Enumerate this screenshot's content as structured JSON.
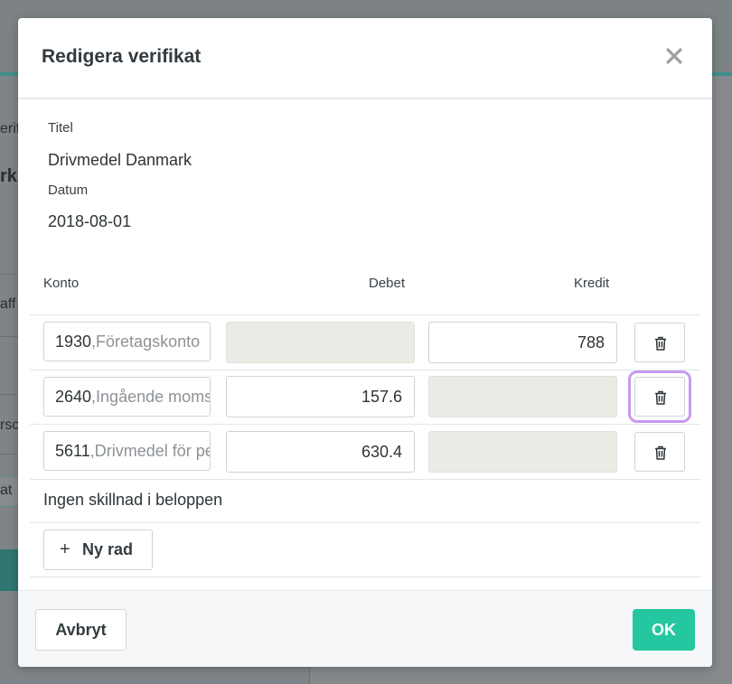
{
  "background": {
    "fragments": [
      "erif",
      "rk",
      "aff",
      "rsc",
      "at"
    ]
  },
  "modal": {
    "title": "Redigera verifikat",
    "close_icon": "close-icon",
    "title_label": "Titel",
    "title_value": "Drivmedel Danmark",
    "date_label": "Datum",
    "date_value": "2018-08-01"
  },
  "table": {
    "headers": {
      "account": "Konto",
      "debit": "Debet",
      "credit": "Kredit"
    },
    "rows": [
      {
        "account_number": "1930",
        "account_name": ",Företagskonto",
        "debit": "",
        "credit": "788"
      },
      {
        "account_number": "2640",
        "account_name": ",Ingående moms",
        "debit": "157.6",
        "credit": ""
      },
      {
        "account_number": "5611",
        "account_name": ",Drivmedel för personbilar",
        "debit": "630.4",
        "credit": ""
      }
    ],
    "delete_icon": "trash-icon"
  },
  "status": {
    "difference": "Ingen skillnad i beloppen"
  },
  "add_row": {
    "plus": "+",
    "label": "Ny rad"
  },
  "footer": {
    "cancel_label": "Avbryt",
    "ok_label": "OK"
  },
  "colors": {
    "accent": "#25c7a0",
    "highlight": "#c79af0",
    "disabled_field": "#ebebe6",
    "backdrop": "#7c8285"
  }
}
